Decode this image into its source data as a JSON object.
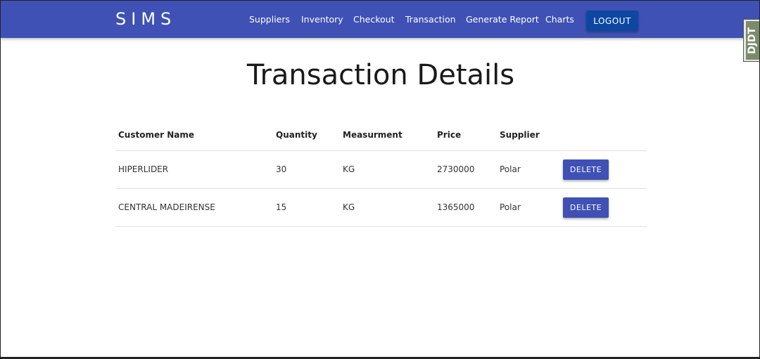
{
  "nav": {
    "brand": "SIMS",
    "links": [
      {
        "label": "Suppliers"
      },
      {
        "label": "Inventory"
      },
      {
        "label": "Checkout"
      },
      {
        "label": "Transaction"
      },
      {
        "label": "Generate Report"
      },
      {
        "label": "Charts"
      }
    ],
    "logout_label": "LOGOUT"
  },
  "side_widget": {
    "text": "DJDT"
  },
  "page": {
    "title": "Transaction Details"
  },
  "table": {
    "headers": [
      "Customer Name",
      "Quantity",
      "Measurment",
      "Price",
      "Supplier",
      ""
    ],
    "rows": [
      {
        "customer": "HIPERLIDER",
        "quantity": "30",
        "measurement": "KG",
        "price": "2730000",
        "supplier": "Polar",
        "action": "DELETE"
      },
      {
        "customer": "CENTRAL MADEIRENSE",
        "quantity": "15",
        "measurement": "KG",
        "price": "1365000",
        "supplier": "Polar",
        "action": "DELETE"
      }
    ]
  },
  "colors": {
    "navbar": "#3f51b5",
    "logout_button": "#0d47a1",
    "delete_button": "#3f51b5"
  }
}
